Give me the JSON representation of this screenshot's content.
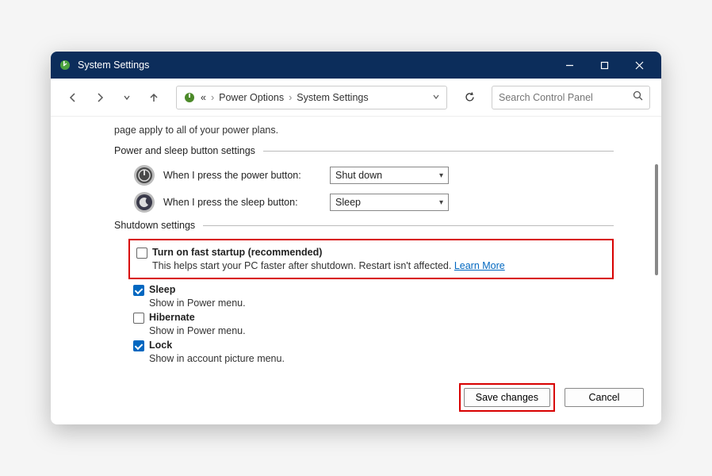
{
  "window": {
    "title": "System Settings"
  },
  "address": {
    "prefix": "«",
    "crumbs": [
      "Power Options",
      "System Settings"
    ]
  },
  "search": {
    "placeholder": "Search Control Panel"
  },
  "intro": "page apply to all of your power plans.",
  "sections": {
    "buttons": {
      "heading": "Power and sleep button settings",
      "power": {
        "label": "When I press the power button:",
        "value": "Shut down"
      },
      "sleep": {
        "label": "When I press the sleep button:",
        "value": "Sleep"
      }
    },
    "shutdown": {
      "heading": "Shutdown settings",
      "fast": {
        "label": "Turn on fast startup (recommended)",
        "desc": "This helps start your PC faster after shutdown. Restart isn't affected. ",
        "link": "Learn More"
      },
      "sleep": {
        "label": "Sleep",
        "desc": "Show in Power menu."
      },
      "hibernate": {
        "label": "Hibernate",
        "desc": "Show in Power menu."
      },
      "lock": {
        "label": "Lock",
        "desc": "Show in account picture menu."
      }
    }
  },
  "buttons": {
    "save": "Save changes",
    "cancel": "Cancel"
  }
}
